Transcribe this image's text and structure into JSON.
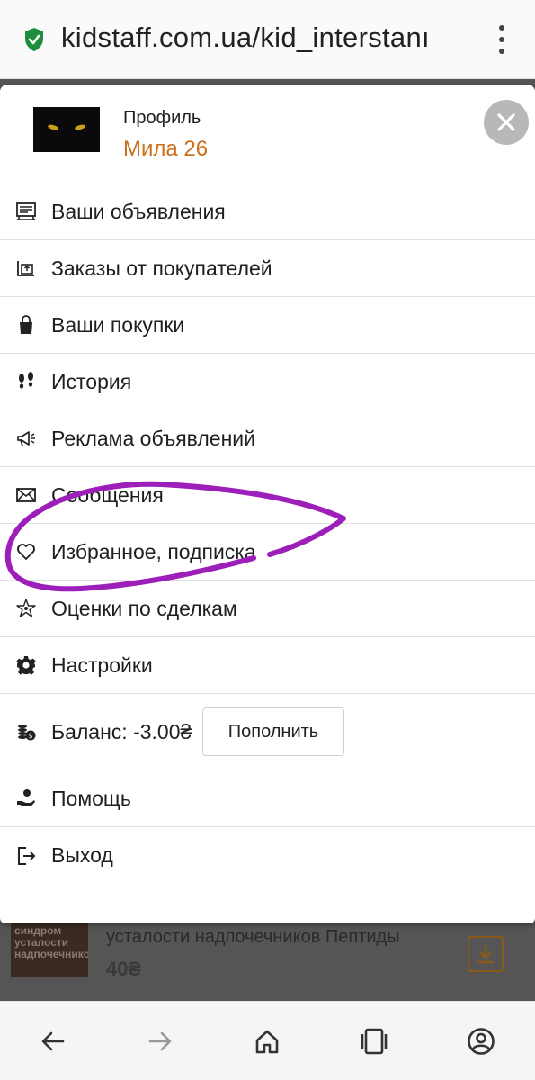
{
  "browser": {
    "url": "kidstaff.com.ua/kid_interstanı"
  },
  "profile": {
    "label": "Профиль",
    "name": "Мила 26"
  },
  "menu": {
    "items": [
      {
        "label": "Ваши объявления",
        "icon": "listing-icon"
      },
      {
        "label": "Заказы от покупателей",
        "icon": "orders-icon"
      },
      {
        "label": "Ваши покупки",
        "icon": "shopping-bag-icon"
      },
      {
        "label": "История",
        "icon": "footprints-icon"
      },
      {
        "label": "Реклама объявлений",
        "icon": "megaphone-icon"
      },
      {
        "label": "Сообщения",
        "icon": "envelope-icon"
      },
      {
        "label": "Избранное, подписка",
        "icon": "heart-icon"
      },
      {
        "label": "Оценки по сделкам",
        "icon": "ratings-icon"
      },
      {
        "label": "Настройки",
        "icon": "gear-icon"
      }
    ],
    "balance": {
      "label": "Баланс: -3.00₴",
      "button": "Пополнить",
      "icon": "coins-icon"
    },
    "bottom_items": [
      {
        "label": "Помощь",
        "icon": "help-hand-icon"
      },
      {
        "label": "Выход",
        "icon": "logout-icon"
      }
    ]
  },
  "background_listing": {
    "thumb_text": "синдром усталости надпочечников",
    "title": "усталости надпочечников Пептиды",
    "price": "40₴"
  },
  "colors": {
    "accent": "#cc6f1b",
    "annotation": "#9b1fb8",
    "shield": "#1e8e3e"
  }
}
